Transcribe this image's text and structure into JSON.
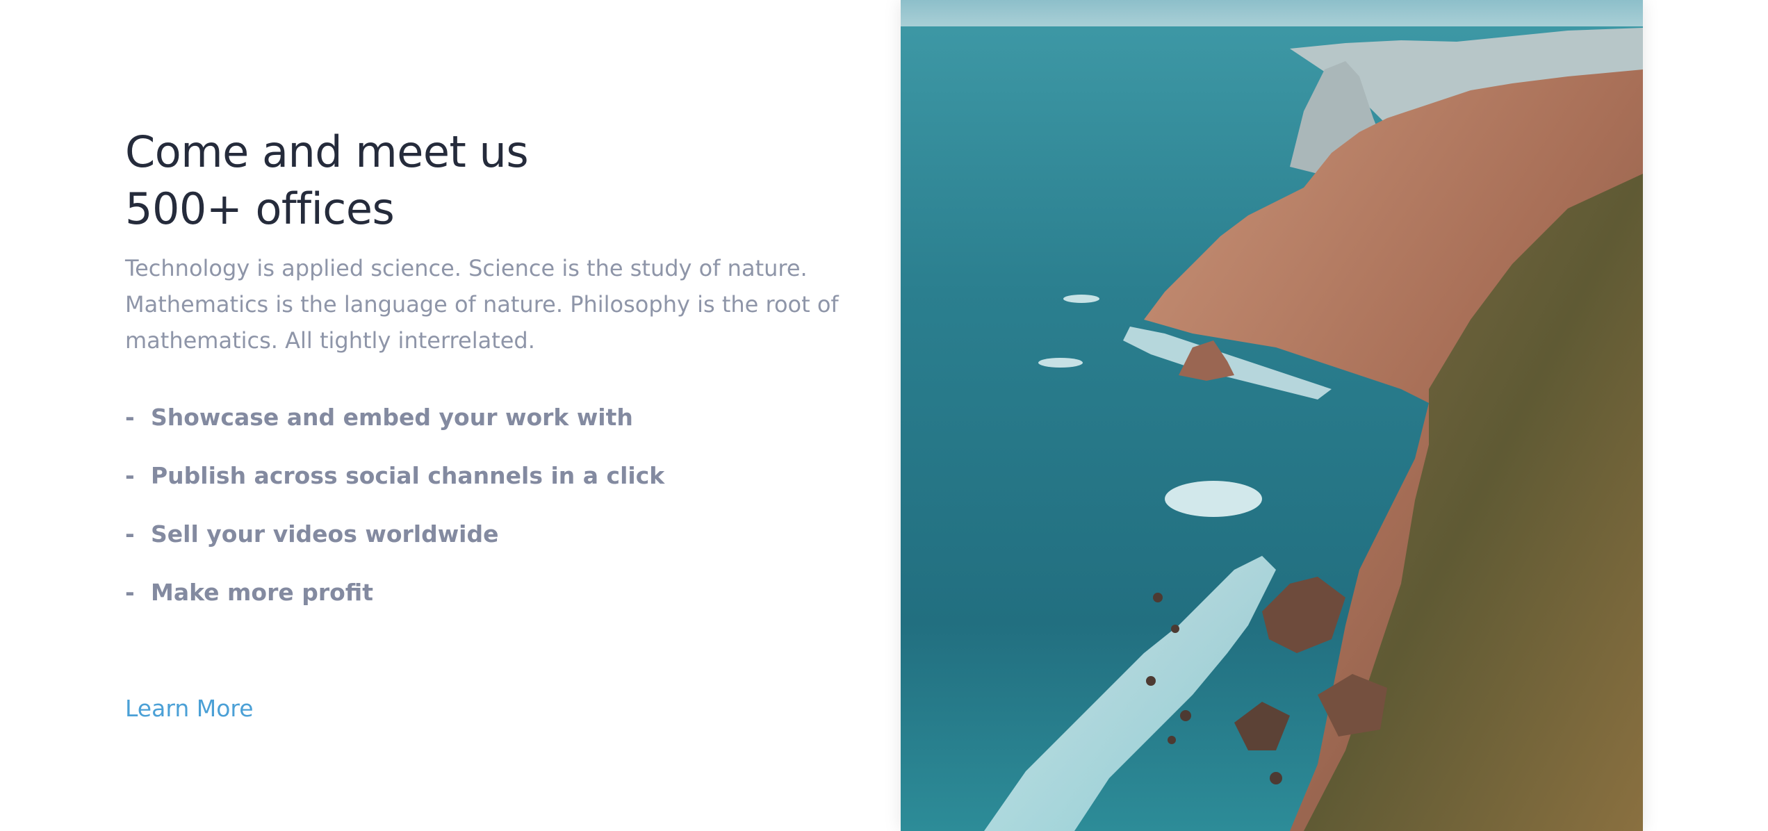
{
  "section": {
    "title_line1": "Come and meet us",
    "title_line2": "500+ offices",
    "description": "Technology is applied science. Science is the study of nature. Mathematics is the language of nature. Philosophy is the root of mathematics. All tightly interrelated.",
    "bullet_marker": "-",
    "features": [
      "Showcase and embed your work with",
      "Publish across social channels in a click",
      "Sell your videos worldwide",
      "Make more profit"
    ],
    "cta_label": "Learn More"
  },
  "image": {
    "icon": "coastline-photo"
  },
  "colors": {
    "heading": "#252b3b",
    "body_text": "#8e95a8",
    "link": "#4ba0d6"
  }
}
